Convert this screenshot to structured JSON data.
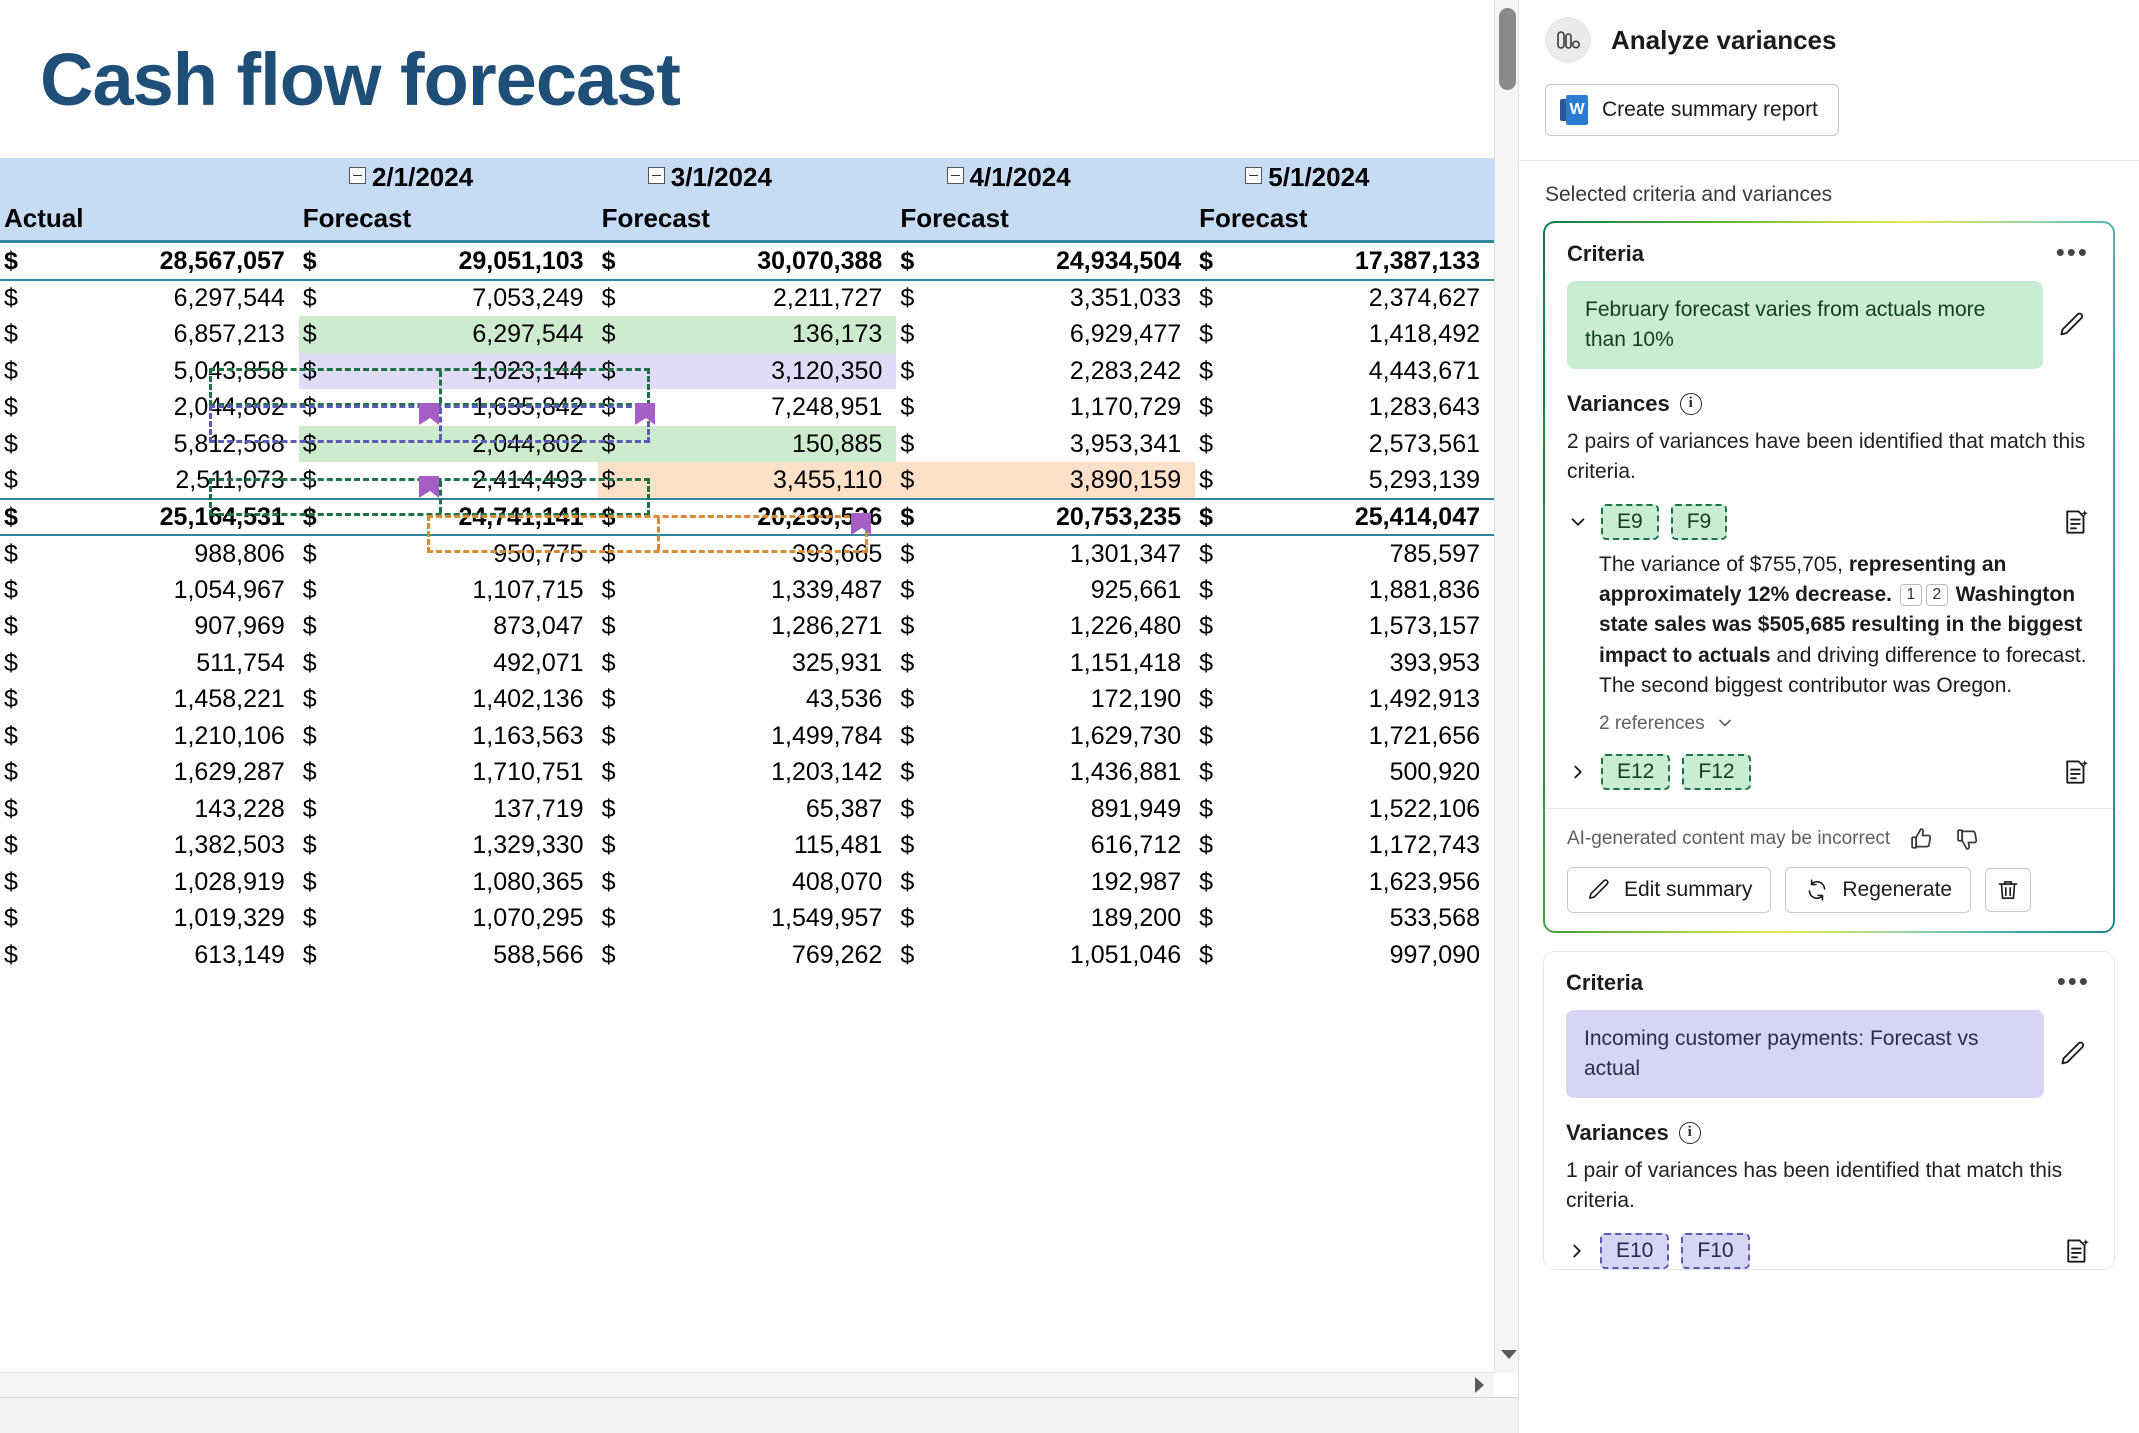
{
  "workbook": {
    "title": "Cash flow forecast",
    "column_groups": [
      {
        "date": null,
        "sub": "Actual"
      },
      {
        "date": "2/1/2024",
        "sub": "Forecast"
      },
      {
        "date": "3/1/2024",
        "sub": "Forecast"
      },
      {
        "date": "4/1/2024",
        "sub": "Forecast"
      },
      {
        "date": "5/1/2024",
        "sub": "Forecast"
      }
    ],
    "currency_symbol": "$",
    "rows": [
      {
        "kind": "total",
        "values": [
          "28,567,057",
          "29,051,103",
          "30,070,388",
          "24,934,504",
          "17,387,133"
        ]
      },
      {
        "kind": "data",
        "values": [
          "6,297,544",
          "7,053,249",
          "2,211,727",
          "3,351,033",
          "2,374,627"
        ]
      },
      {
        "kind": "data",
        "values": [
          "6,857,213",
          "6,297,544",
          "136,173",
          "6,929,477",
          "1,418,492"
        ],
        "highlight": "green"
      },
      {
        "kind": "data",
        "values": [
          "5,043,858",
          "1,023,144",
          "3,120,350",
          "2,283,242",
          "4,443,671"
        ],
        "highlight": "purple"
      },
      {
        "kind": "data",
        "values": [
          "2,044,802",
          "1,635,842",
          "7,248,951",
          "1,170,729",
          "1,283,643"
        ]
      },
      {
        "kind": "data",
        "values": [
          "5,812,568",
          "2,044,802",
          "150,885",
          "3,953,341",
          "2,573,561"
        ],
        "highlight": "green"
      },
      {
        "kind": "data",
        "values": [
          "2,511,073",
          "2,414,493",
          "3,455,110",
          "3,890,159",
          "5,293,139"
        ],
        "highlight": "orange"
      },
      {
        "kind": "total",
        "values": [
          "25,164,531",
          "24,741,141",
          "20,239,536",
          "20,753,235",
          "25,414,047"
        ]
      },
      {
        "kind": "data",
        "values": [
          "988,806",
          "950,775",
          "393,665",
          "1,301,347",
          "785,597"
        ]
      },
      {
        "kind": "data",
        "values": [
          "1,054,967",
          "1,107,715",
          "1,339,487",
          "925,661",
          "1,881,836"
        ]
      },
      {
        "kind": "data",
        "values": [
          "907,969",
          "873,047",
          "1,286,271",
          "1,226,480",
          "1,573,157"
        ]
      },
      {
        "kind": "data",
        "values": [
          "511,754",
          "492,071",
          "325,931",
          "1,151,418",
          "393,953"
        ]
      },
      {
        "kind": "data",
        "values": [
          "1,458,221",
          "1,402,136",
          "43,536",
          "172,190",
          "1,492,913"
        ]
      },
      {
        "kind": "data",
        "values": [
          "1,210,106",
          "1,163,563",
          "1,499,784",
          "1,629,730",
          "1,721,656"
        ]
      },
      {
        "kind": "data",
        "values": [
          "1,629,287",
          "1,710,751",
          "1,203,142",
          "1,436,881",
          "500,920"
        ]
      },
      {
        "kind": "data",
        "values": [
          "143,228",
          "137,719",
          "65,387",
          "891,949",
          "1,522,106"
        ]
      },
      {
        "kind": "data",
        "values": [
          "1,382,503",
          "1,329,330",
          "115,481",
          "616,712",
          "1,172,743"
        ]
      },
      {
        "kind": "data",
        "values": [
          "1,028,919",
          "1,080,365",
          "408,070",
          "192,987",
          "1,623,956"
        ]
      },
      {
        "kind": "data",
        "values": [
          "1,019,329",
          "1,070,295",
          "1,549,957",
          "189,200",
          "533,568"
        ]
      },
      {
        "kind": "data",
        "values": [
          "613,149",
          "588,566",
          "769,262",
          "1,051,046",
          "997,090"
        ],
        "clipped": true
      }
    ]
  },
  "task_pane": {
    "title": "Analyze variances",
    "header_icon": "columns-chart-icon",
    "create_report_button": "Create summary report",
    "section_label": "Selected criteria and variances",
    "cards": [
      {
        "active": true,
        "criteria_label": "Criteria",
        "criteria_text": "February forecast varies from actuals more than 10%",
        "criteria_color": "green",
        "variances_label": "Variances",
        "variances_summary": "2 pairs of variances have been identified that match this criteria.",
        "items": [
          {
            "expanded": true,
            "refs": [
              "E9",
              "F9"
            ],
            "ref_color": "green",
            "body_segments": [
              {
                "text": "The variance of $755,705, ",
                "bold": false
              },
              {
                "text": "representing an approximately 12% decrease.",
                "bold": true
              }
            ],
            "citations": [
              "1",
              "2"
            ],
            "body_segments_after": [
              {
                "text": " Washington state sales was $505,685 resulting in the biggest impact to actuals",
                "bold": true
              },
              {
                "text": " and driving difference to forecast. The second biggest contributor was Oregon.",
                "bold": false
              }
            ],
            "references_toggle": "2 references"
          },
          {
            "expanded": false,
            "refs": [
              "E12",
              "F12"
            ],
            "ref_color": "green"
          }
        ],
        "ai_note": "AI-generated content may be incorrect",
        "edit_button": "Edit summary",
        "regenerate_button": "Regenerate",
        "delete_button_icon": "trash-icon"
      },
      {
        "active": false,
        "criteria_label": "Criteria",
        "criteria_text": "Incoming customer payments: Forecast vs actual",
        "criteria_color": "purple",
        "variances_label": "Variances",
        "variances_summary": "1 pair of variances has been identified that match this criteria.",
        "items": [
          {
            "expanded": false,
            "refs": [
              "E10",
              "F10"
            ],
            "ref_color": "purple"
          }
        ]
      }
    ]
  },
  "colors": {
    "title_blue": "#1f4e79",
    "header_band": "#c6dcf4",
    "rule_teal": "#31859c",
    "highlight_green": "#cdeccd",
    "highlight_purple": "#dedcf7",
    "highlight_orange": "#fce0c8",
    "border_green": "#1e7145",
    "border_purple": "#5b5bb5",
    "border_orange": "#d98b33",
    "flag_purple": "#a55fc4"
  }
}
